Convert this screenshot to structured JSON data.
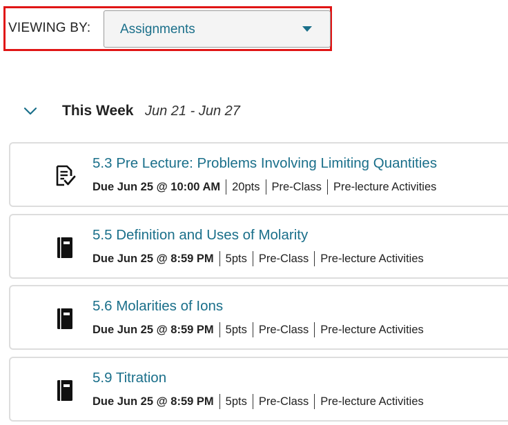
{
  "filter": {
    "label": "VIEWING BY:",
    "selected": "Assignments",
    "caret_icon": "caret-down-icon",
    "highlight_color": "#e01515"
  },
  "week": {
    "toggle_icon": "chevron-down-icon",
    "title": "This Week",
    "range": "Jun 21 - Jun 27"
  },
  "colors": {
    "accent": "#1a6f8a",
    "card_border": "#dddddd"
  },
  "assignments": [
    {
      "icon": "quiz-checklist-icon",
      "title": "5.3 Pre Lecture: Problems Involving Limiting Quantities",
      "due": "Due Jun 25 @ 10:00 AM",
      "points": "20pts",
      "category": "Pre-Class",
      "type": "Pre-lecture Activities"
    },
    {
      "icon": "book-icon",
      "title": "5.5 Definition and Uses of Molarity",
      "due": "Due Jun 25 @ 8:59 PM",
      "points": "5pts",
      "category": "Pre-Class",
      "type": "Pre-lecture Activities"
    },
    {
      "icon": "book-icon",
      "title": "5.6 Molarities of Ions",
      "due": "Due Jun 25 @ 8:59 PM",
      "points": "5pts",
      "category": "Pre-Class",
      "type": "Pre-lecture Activities"
    },
    {
      "icon": "book-icon",
      "title": "5.9 Titration",
      "due": "Due Jun 25 @ 8:59 PM",
      "points": "5pts",
      "category": "Pre-Class",
      "type": "Pre-lecture Activities"
    }
  ]
}
